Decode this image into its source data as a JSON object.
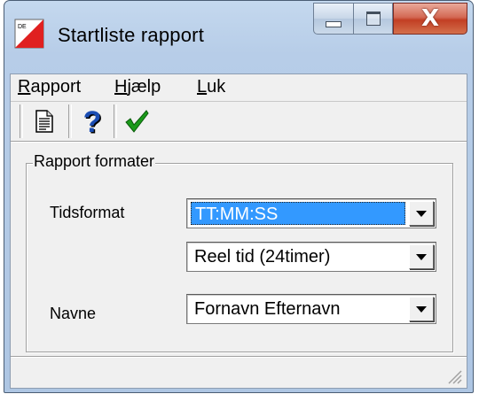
{
  "window": {
    "title": "Startliste rapport",
    "close_symbol": "X",
    "app_icon": "red-white-flag-icon"
  },
  "menu": [
    {
      "label": "Rapport",
      "mnemonic": "R",
      "rest": "apport"
    },
    {
      "label": "Hjælp",
      "mnemonic": "H",
      "rest": "jælp"
    },
    {
      "label": "Luk",
      "mnemonic": "L",
      "rest": "uk"
    }
  ],
  "toolbar": {
    "buttons": [
      {
        "icon": "document-icon"
      },
      {
        "icon": "help-icon",
        "glyph": "?"
      },
      {
        "icon": "checkmark-icon"
      }
    ]
  },
  "group": {
    "title": "Rapport formater"
  },
  "fields": {
    "tidsformat": {
      "label": "Tidsformat",
      "value": "TT:MM:SS"
    },
    "tidstype": {
      "value": "Reel tid (24timer)"
    },
    "navne": {
      "label": "Navne",
      "value": "Fornavn Efternavn"
    }
  },
  "colors": {
    "selection": "#3399ff",
    "check": "#1a9a1a",
    "help": "#1b4db3"
  }
}
